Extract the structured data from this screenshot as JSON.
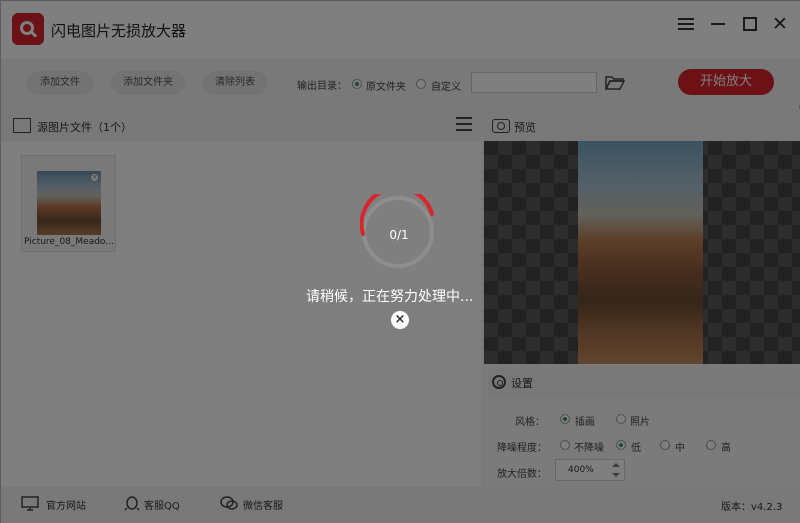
{
  "app": {
    "title": "闪电图片无损放大器",
    "version": "版本：v4.2.3"
  },
  "toolbar": {
    "add_file": "添加文件",
    "add_folder": "添加文件夹",
    "clear_list": "清除列表",
    "output_label": "输出目录：",
    "output_options": [
      "原文件夹",
      "自定义"
    ],
    "selected_output": "原文件夹",
    "path_value": "",
    "start": "开始放大"
  },
  "left": {
    "title": "源图片文件（1个）",
    "files": [
      {
        "name": "Picture_08_Meado..."
      }
    ]
  },
  "right": {
    "preview_title": "预览",
    "settings_title": "设置",
    "style_label": "风格：",
    "style_options": [
      "插画",
      "照片"
    ],
    "style_selected": "插画",
    "noise_label": "降噪程度：",
    "noise_options": [
      "不降噪",
      "低",
      "中",
      "高"
    ],
    "noise_selected": "低",
    "zoom_label": "放大倍数：",
    "zoom_value": "400%"
  },
  "status": {
    "website": "官方网站",
    "qq": "客服QQ",
    "wechat": "微信客服"
  },
  "overlay": {
    "progress": "0/1",
    "progress_fraction": 0,
    "message": "请稍候，正在努力处理中..."
  },
  "colors": {
    "accent_red": "#d9252c",
    "radio_green": "#21a654"
  }
}
